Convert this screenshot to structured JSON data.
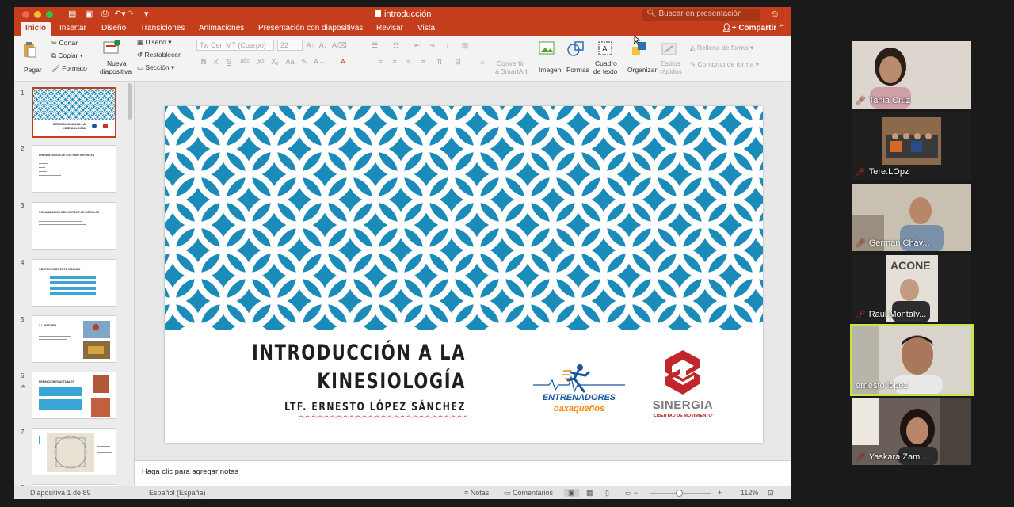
{
  "window": {
    "title": "introducción",
    "search_placeholder": "Buscar en presentación"
  },
  "ribbon": {
    "tabs": [
      "Inicio",
      "Insertar",
      "Diseño",
      "Transiciones",
      "Animaciones",
      "Presentación con diapositivas",
      "Revisar",
      "Vista"
    ],
    "share_label": "Compartir",
    "paste_label": "Pegar",
    "cut_label": "Cortar",
    "copy_label": "Copiar",
    "format_label": "Formato",
    "new_slide_label_1": "Nueva",
    "new_slide_label_2": "diapositiva",
    "layout_label": "Diseño",
    "reset_label": "Restablecer",
    "section_label": "Sección",
    "font_name": "Tw Cen MT (Cuerpo)",
    "font_size": "22",
    "convert_smartart_1": "Convertir",
    "convert_smartart_2": "a SmartArt",
    "image_label": "Imagen",
    "shapes_label": "Formas",
    "textbox_label_1": "Cuadro",
    "textbox_label_2": "de texto",
    "arrange_label": "Organizar",
    "quick_styles_1": "Estilos",
    "quick_styles_2": "rápidos",
    "shape_fill_label": "Relleno de forma",
    "shape_outline_label": "Contorno de forma"
  },
  "thumbnails": [
    {
      "num": "1",
      "title": "INTRODUCCIÓN A LA KINESIOLOGÍA"
    },
    {
      "num": "2",
      "title": "PRESENTACIÓN DE LOS PARTICIPANTES"
    },
    {
      "num": "3",
      "title": "ORGANIZACIÓN DEL CURSO POR MÓDULOS"
    },
    {
      "num": "4",
      "title": "OBJETIVOS DE ESTE MÓDULO"
    },
    {
      "num": "5",
      "title": "1.1 HISTORIA"
    },
    {
      "num": "6",
      "title": "DEFINICIONES ACTUALES"
    },
    {
      "num": "7",
      "title": ""
    },
    {
      "num": "8",
      "title": ""
    }
  ],
  "slide": {
    "title_line1": "INTRODUCCIÓN A LA",
    "title_line2": "KINESIOLOGÍA",
    "subtitle": "LTF. ERNESTO LÓPEZ SÁNCHEZ",
    "logo1_line1": "ENTRENADORES",
    "logo1_line2": "oaxaqueños",
    "logo2_name": "SINERGIA",
    "logo2_tagline": "\"LIBERTAD DE MOVIMIENTO\"",
    "pattern_color": "#1b8bb9"
  },
  "notes_placeholder": "Haga clic para agregar notas",
  "status": {
    "slide_indicator": "Diapositiva 1 de 89",
    "language": "Español (España)",
    "notes_label": "Notas",
    "comments_label": "Comentarios",
    "zoom": "112%"
  },
  "participants": [
    {
      "name": "Tania Cruz"
    },
    {
      "name": "Tere.LOpz"
    },
    {
      "name": "Germán Cháv..."
    },
    {
      "name": "Raúl Montalv..."
    },
    {
      "name": "ernesto lopez"
    },
    {
      "name": "Yaskara Zam..."
    }
  ],
  "colors": {
    "accent": "#c43e1c",
    "active_speaker": "#c7e44c"
  }
}
